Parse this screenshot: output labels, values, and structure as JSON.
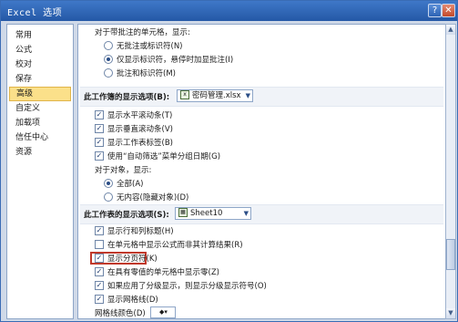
{
  "window": {
    "title": "Excel 选项",
    "help_label": "?",
    "close_label": "✕"
  },
  "sidebar": {
    "items": [
      {
        "label": "常用"
      },
      {
        "label": "公式"
      },
      {
        "label": "校对"
      },
      {
        "label": "保存"
      },
      {
        "label": "高级",
        "active": true
      },
      {
        "label": "自定义"
      },
      {
        "label": "加载项"
      },
      {
        "label": "信任中心"
      },
      {
        "label": "资源"
      }
    ]
  },
  "comments": {
    "heading": "对于带批注的单元格，显示:",
    "options": [
      {
        "label": "无批注或标识符(N)",
        "selected": false
      },
      {
        "label": "仅显示标识符，悬停时加显批注(I)",
        "selected": true
      },
      {
        "label": "批注和标识符(M)",
        "selected": false
      }
    ]
  },
  "workbook_section": {
    "label": "此工作簿的显示选项(B):",
    "combo_value": "密码管理.xlsx",
    "checks": [
      {
        "label": "显示水平滚动条(T)",
        "checked": true
      },
      {
        "label": "显示垂直滚动条(V)",
        "checked": true
      },
      {
        "label": "显示工作表标签(B)",
        "checked": true
      },
      {
        "label": "使用“自动筛选”菜单分组日期(G)",
        "checked": true
      }
    ],
    "objects_heading": "对于对象，显示:",
    "object_options": [
      {
        "label": "全部(A)",
        "selected": true
      },
      {
        "label": "无内容(隐藏对象)(D)",
        "selected": false
      }
    ]
  },
  "sheet_section": {
    "label": "此工作表的显示选项(S):",
    "combo_value": "Sheet10",
    "checks": [
      {
        "label": "显示行和列标题(H)",
        "checked": true
      },
      {
        "label": "在单元格中显示公式而非其计算结果(R)",
        "checked": false
      },
      {
        "label": "显示分页符(K)",
        "checked": true,
        "highlighted": true
      },
      {
        "label": "在具有零值的单元格中显示零(Z)",
        "checked": true
      },
      {
        "label": "如果应用了分级显示，则显示分级显示符号(O)",
        "checked": true
      },
      {
        "label": "显示网格线(D)",
        "checked": true
      }
    ],
    "gridline_color_label": "网格线颜色(D)"
  },
  "colors": {
    "accent": "#2458a6",
    "active_item": "#fbe08a",
    "highlight_border": "#c0392b"
  }
}
